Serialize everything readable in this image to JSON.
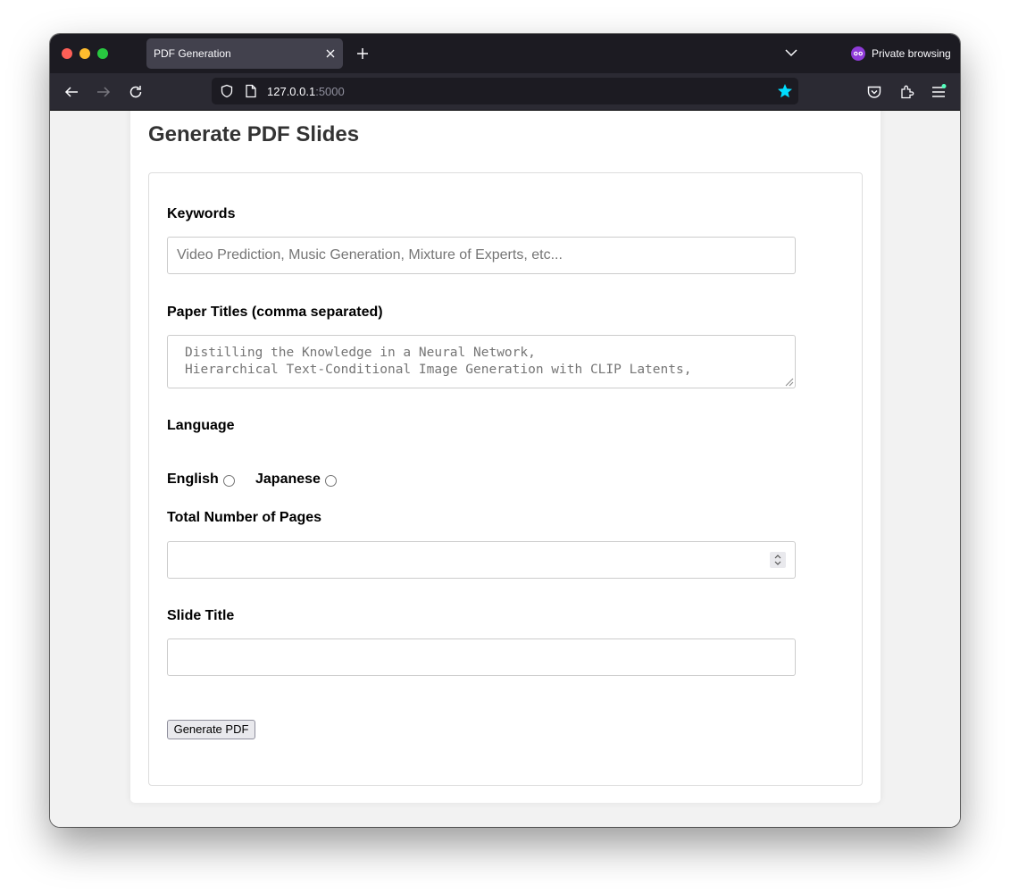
{
  "browser": {
    "tab_title": "PDF Generation",
    "private_label": "Private browsing",
    "url_host": "127.0.0.1",
    "url_port": ":5000"
  },
  "page": {
    "title": "Generate PDF Slides",
    "keywords": {
      "label": "Keywords",
      "value": "",
      "placeholder": "Video Prediction, Music Generation, Mixture of Experts, etc..."
    },
    "paper_titles": {
      "label": "Paper Titles (comma separated)",
      "lines": [
        "Distilling the Knowledge in a Neural Network,",
        "Hierarchical Text-Conditional Image Generation with CLIP Latents,"
      ]
    },
    "language": {
      "label": "Language",
      "options": [
        {
          "label": "English",
          "selected": false
        },
        {
          "label": "Japanese",
          "selected": false
        }
      ]
    },
    "pages": {
      "label": "Total Number of Pages",
      "value": ""
    },
    "slide_title": {
      "label": "Slide Title",
      "value": ""
    },
    "submit_label": "Generate PDF"
  },
  "colors": {
    "accent_star": "#00ddff",
    "private_purple": "#8f3bd9"
  }
}
